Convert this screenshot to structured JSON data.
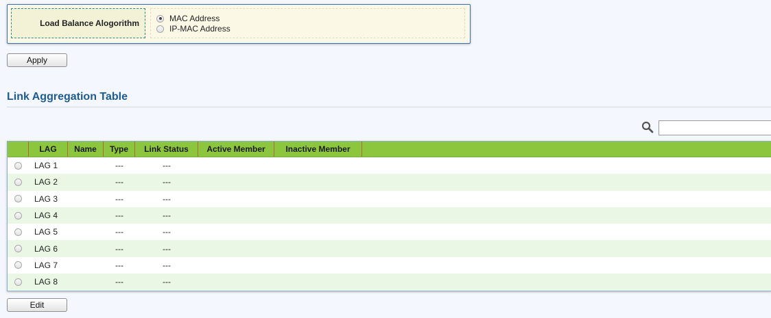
{
  "load_balance": {
    "label": "Load Balance Alogorithm",
    "options": [
      {
        "label": "MAC Address",
        "checked": true
      },
      {
        "label": "IP-MAC Address",
        "checked": false
      }
    ]
  },
  "apply_label": "Apply",
  "section_title": "Link Aggregation Table",
  "search": {
    "value": ""
  },
  "table": {
    "columns": [
      "LAG",
      "Name",
      "Type",
      "Link Status",
      "Active Member",
      "Inactive Member"
    ],
    "rows": [
      {
        "lag": "LAG 1",
        "name": "",
        "type": "---",
        "link_status": "---",
        "active_member": "",
        "inactive_member": ""
      },
      {
        "lag": "LAG 2",
        "name": "",
        "type": "---",
        "link_status": "---",
        "active_member": "",
        "inactive_member": ""
      },
      {
        "lag": "LAG 3",
        "name": "",
        "type": "---",
        "link_status": "---",
        "active_member": "",
        "inactive_member": ""
      },
      {
        "lag": "LAG 4",
        "name": "",
        "type": "---",
        "link_status": "---",
        "active_member": "",
        "inactive_member": ""
      },
      {
        "lag": "LAG 5",
        "name": "",
        "type": "---",
        "link_status": "---",
        "active_member": "",
        "inactive_member": ""
      },
      {
        "lag": "LAG 6",
        "name": "",
        "type": "---",
        "link_status": "---",
        "active_member": "",
        "inactive_member": ""
      },
      {
        "lag": "LAG 7",
        "name": "",
        "type": "---",
        "link_status": "---",
        "active_member": "",
        "inactive_member": ""
      },
      {
        "lag": "LAG 8",
        "name": "",
        "type": "---",
        "link_status": "---",
        "active_member": "",
        "inactive_member": ""
      }
    ]
  },
  "edit_label": "Edit",
  "colors": {
    "header_green": "#8cc63e",
    "title_blue": "#1d5a94",
    "row_alt": "#e9f7e4"
  }
}
